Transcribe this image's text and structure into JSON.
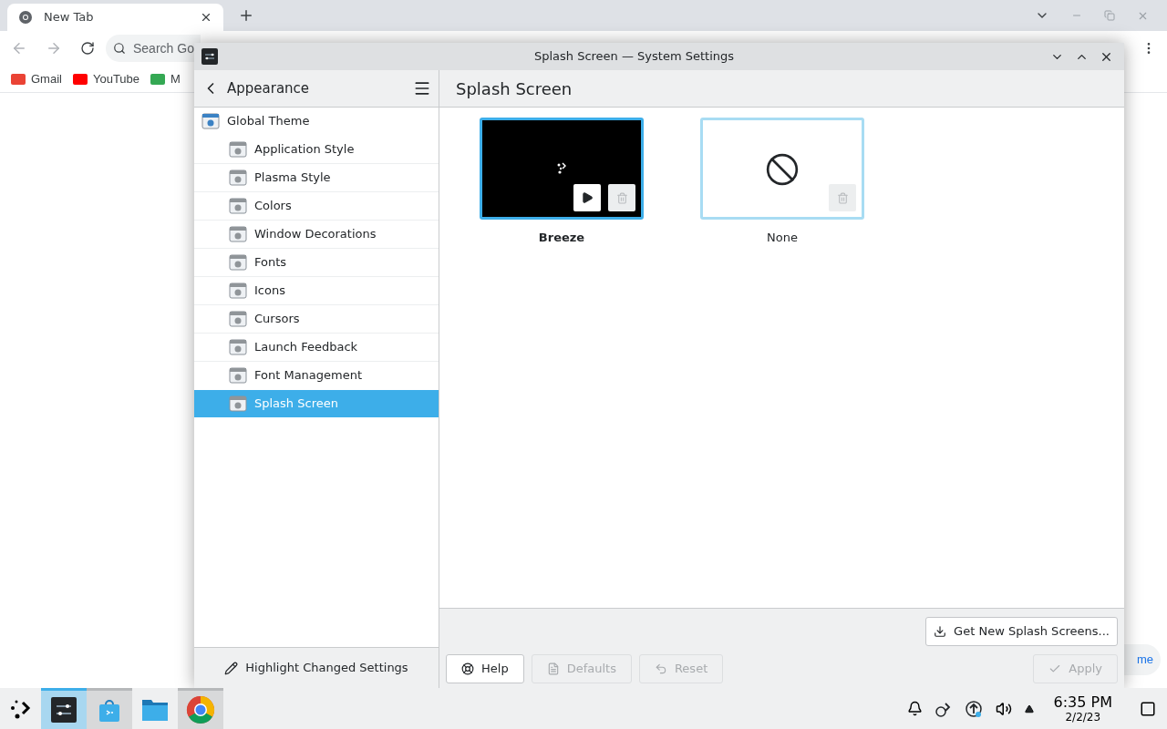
{
  "browser": {
    "tab": {
      "title": "New Tab"
    },
    "search": {
      "placeholder": "Search Go"
    },
    "bookmarks": [
      {
        "label": "Gmail"
      },
      {
        "label": "YouTube"
      },
      {
        "label": "M"
      }
    ],
    "side_button": {
      "label": "me"
    }
  },
  "window": {
    "title": "Splash Screen — System Settings"
  },
  "sidebar": {
    "title": "Appearance",
    "items": [
      {
        "label": "Global Theme",
        "selected": false,
        "children": [
          {
            "label": "Application Style",
            "selected": false
          },
          {
            "label": "Plasma Style",
            "selected": false
          },
          {
            "label": "Colors",
            "selected": false
          },
          {
            "label": "Window Decorations",
            "selected": false
          },
          {
            "label": "Fonts",
            "selected": false
          },
          {
            "label": "Icons",
            "selected": false
          },
          {
            "label": "Cursors",
            "selected": false
          },
          {
            "label": "Launch Feedback",
            "selected": false
          },
          {
            "label": "Font Management",
            "selected": false
          },
          {
            "label": "Splash Screen",
            "selected": true
          }
        ]
      }
    ],
    "footer_button": "Highlight Changed Settings"
  },
  "page": {
    "title": "Splash Screen",
    "themes": [
      {
        "name": "Breeze",
        "kind": "preview",
        "selected": true
      },
      {
        "name": "None",
        "kind": "none",
        "selected": false
      }
    ],
    "get_new_button": "Get New Splash Screens...",
    "buttons": [
      {
        "label": "Help",
        "disabled": false
      },
      {
        "label": "Defaults",
        "disabled": true
      },
      {
        "label": "Reset",
        "disabled": true
      }
    ],
    "apply": {
      "label": "Apply",
      "disabled": true
    }
  },
  "taskbar": {
    "apps": [
      {
        "kind": "settings",
        "active": true,
        "open": true
      },
      {
        "kind": "store",
        "active": false,
        "open": true
      },
      {
        "kind": "files",
        "active": false,
        "open": false
      },
      {
        "kind": "chrome",
        "active": false,
        "open": true
      }
    ],
    "clock": {
      "time": "6:35 PM",
      "date": "2/2/23"
    }
  }
}
